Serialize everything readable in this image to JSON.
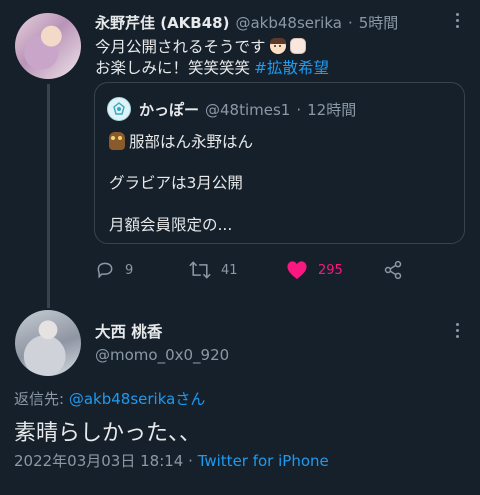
{
  "tweet": {
    "author_name": "永野芹佳 (AKB48)",
    "author_handle": "@akb48serika",
    "separator": "·",
    "time": "5時間",
    "text_line1": "今月公開されるそうです",
    "text_line2_prefix": "お楽しみに！笑笑笑笑",
    "hashtag": "#拡散希望",
    "emoji1": "person-face-emoji",
    "emoji2": "raised-fist-emoji"
  },
  "quote": {
    "author_name": "かっぽー",
    "author_handle": "@48times1",
    "separator": "·",
    "time": "12時間",
    "line1": "服部はん永野はん",
    "line2": "グラビアは3月公開",
    "line3": "月額会員限定の...",
    "emoji": "owl-emoji"
  },
  "actions": {
    "reply_count": "9",
    "retweet_count": "41",
    "like_count": "295",
    "like_color": "#f91880"
  },
  "reply": {
    "author_name": "大西 桃香",
    "author_handle": "@momo_0x0_920",
    "reply_to_label": "返信先:",
    "reply_to_handle": "@akb48serika",
    "reply_to_suffix": "さん",
    "text": "素晴らしかった、、",
    "timestamp": "2022年03月03日 18:14",
    "meta_separator": "·",
    "source": "Twitter for iPhone"
  },
  "colors": {
    "background": "#15202b",
    "link": "#1d9bf0",
    "secondary_text": "#8b98a5",
    "border": "#38444d"
  }
}
